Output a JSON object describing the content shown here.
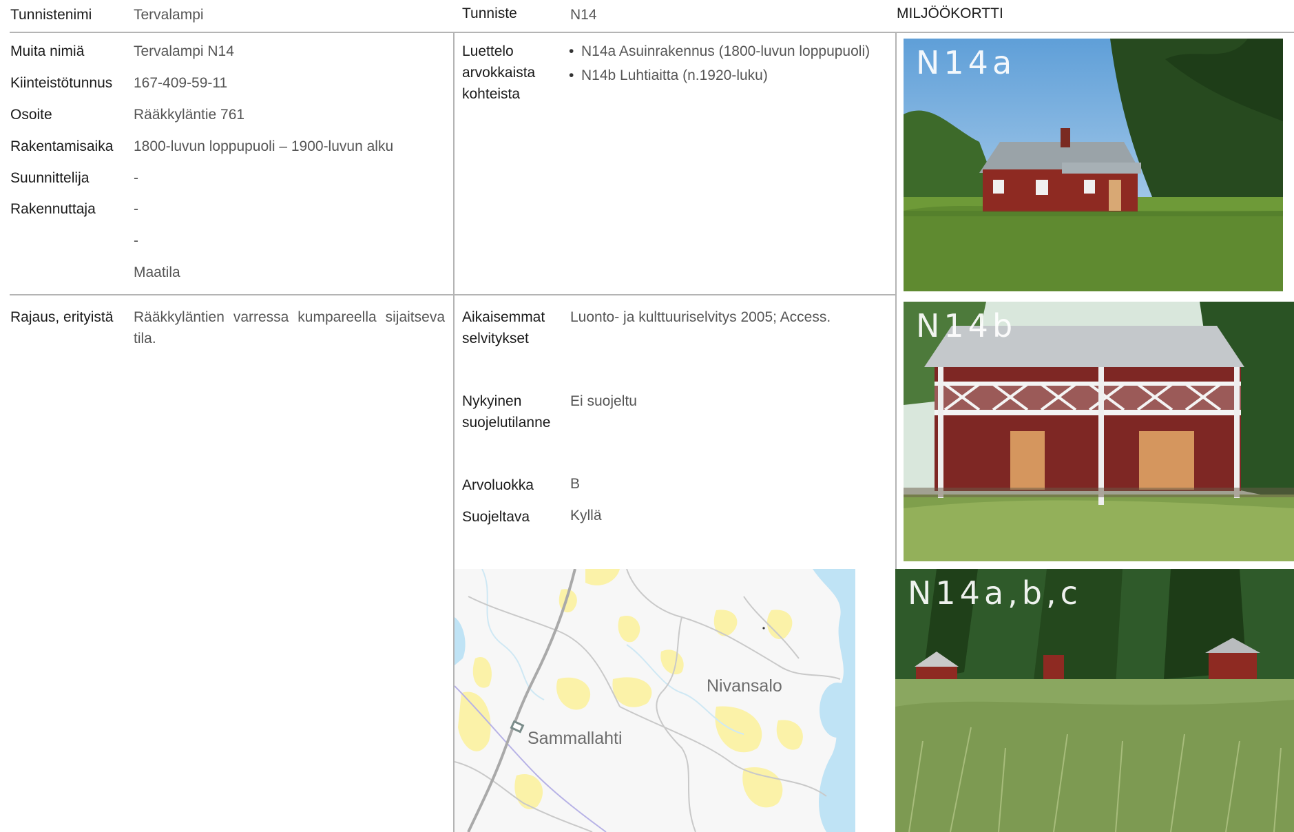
{
  "header": {
    "tunnistenimi_label": "Tunnistenimi",
    "tunnistenimi_value": "Tervalampi",
    "tunniste_label": "Tunniste",
    "tunniste_value": "N14",
    "card_title": "MILJÖÖKORTTI"
  },
  "info": {
    "muita_nimia_label": "Muita nimiä",
    "muita_nimia_value": "Tervalampi N14",
    "kiinteistotunnus_label": "Kiinteistötunnus",
    "kiinteistotunnus_value": "167-409-59-11",
    "osoite_label": "Osoite",
    "osoite_value": "Rääkkyläntie 761",
    "rakentamisaika_label": "Rakentamisaika",
    "rakentamisaika_value": "1800-luvun loppupuoli – 1900-luvun alku",
    "suunnittelija_label": "Suunnittelija",
    "suunnittelija_value": "-",
    "rakennuttaja_label": "Rakennuttaja",
    "rakennuttaja_value": "-",
    "extra_value_1": "-",
    "extra_value_2": "Maatila"
  },
  "objects": {
    "label": "Luettelo arvokkaista kohteista",
    "items": [
      "N14a Asuinrakennus (1800-luvun loppupuoli)",
      "N14b Luhtiaitta (n.1920-luku)"
    ]
  },
  "rajaus": {
    "label": "Rajaus, erityistä",
    "value": "Rääkkyläntien varressa kumpareella sijaitseva tila."
  },
  "details": {
    "aikaisemmat_label": "Aikaisemmat selvitykset",
    "aikaisemmat_value": "Luonto- ja kulttuuriselvitys 2005; Access.",
    "nykyinen_label": "Nykyinen suojelutilanne",
    "nykyinen_value": "Ei suojeltu",
    "arvoluokka_label": "Arvoluokka",
    "arvoluokka_value": "B",
    "suojeltava_label": "Suojeltava",
    "suojeltava_value": "Kyllä"
  },
  "map": {
    "place_1": "Nivansalo",
    "place_2": "Sammallahti"
  },
  "photos": {
    "photo_1_label": "N14a",
    "photo_2_label": "N14b",
    "photo_3_label": "N14a,b,c"
  },
  "colors": {
    "rule": "#b4b4b4",
    "house_red": "#8e2a22",
    "grass": "#6f9a3a",
    "sky": "#7fb2de",
    "map_water": "#bfe3f5",
    "map_field": "#fbf2a8"
  }
}
